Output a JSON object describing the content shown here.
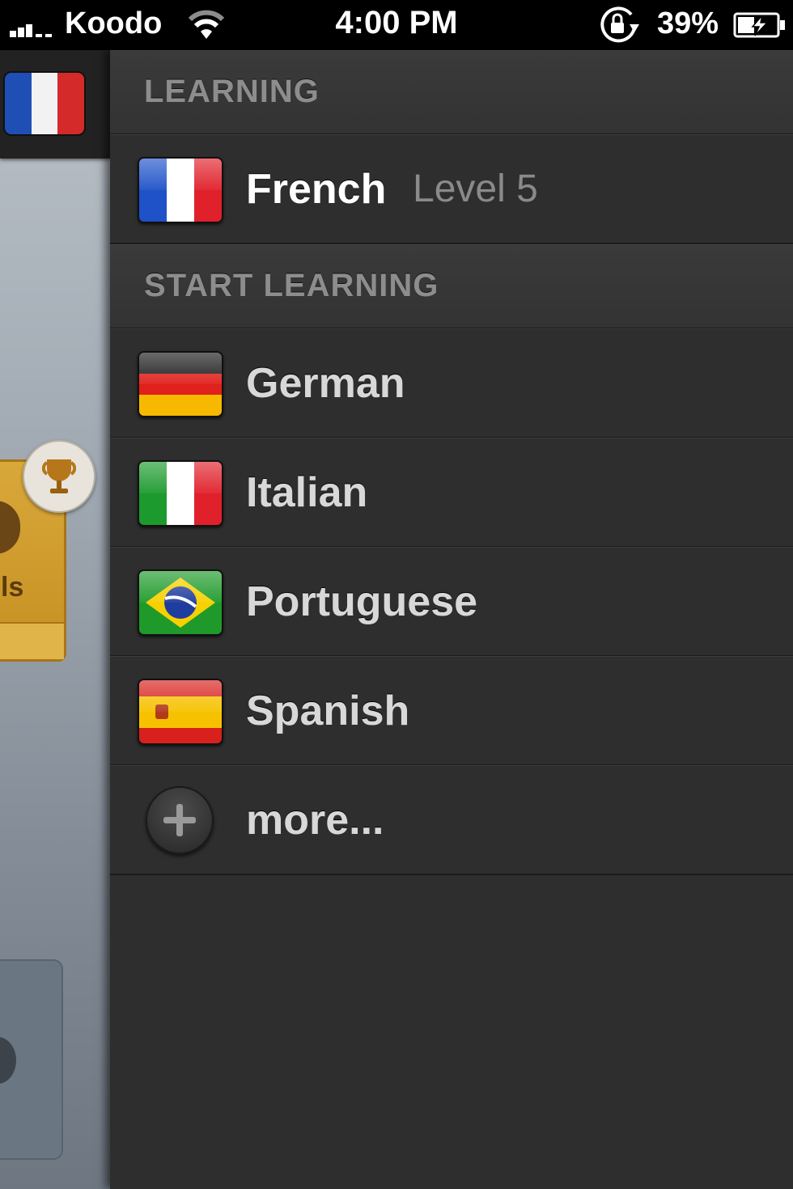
{
  "status_bar": {
    "carrier": "Koodo",
    "time": "4:00 PM",
    "battery_percent": "39%",
    "icons": [
      "signal-icon",
      "wifi-icon",
      "orientation-lock-icon",
      "battery-charging-icon"
    ]
  },
  "underlay": {
    "card_label": "ls",
    "icons": [
      "french-flag-icon",
      "trophy-icon"
    ]
  },
  "menu": {
    "learning_header": "LEARNING",
    "current": {
      "name": "French",
      "level": "Level 5",
      "flag": "france-flag-icon"
    },
    "start_learning_header": "START LEARNING",
    "languages": [
      {
        "name": "German",
        "flag": "germany-flag-icon"
      },
      {
        "name": "Italian",
        "flag": "italy-flag-icon"
      },
      {
        "name": "Portuguese",
        "flag": "brazil-flag-icon"
      },
      {
        "name": "Spanish",
        "flag": "spain-flag-icon"
      }
    ],
    "more_label": "more...",
    "more_icon": "plus-icon"
  },
  "colors": {
    "menu_background": "#2e2e2e",
    "header_text": "#8d8d8d",
    "level_text": "#8a8a8a"
  }
}
